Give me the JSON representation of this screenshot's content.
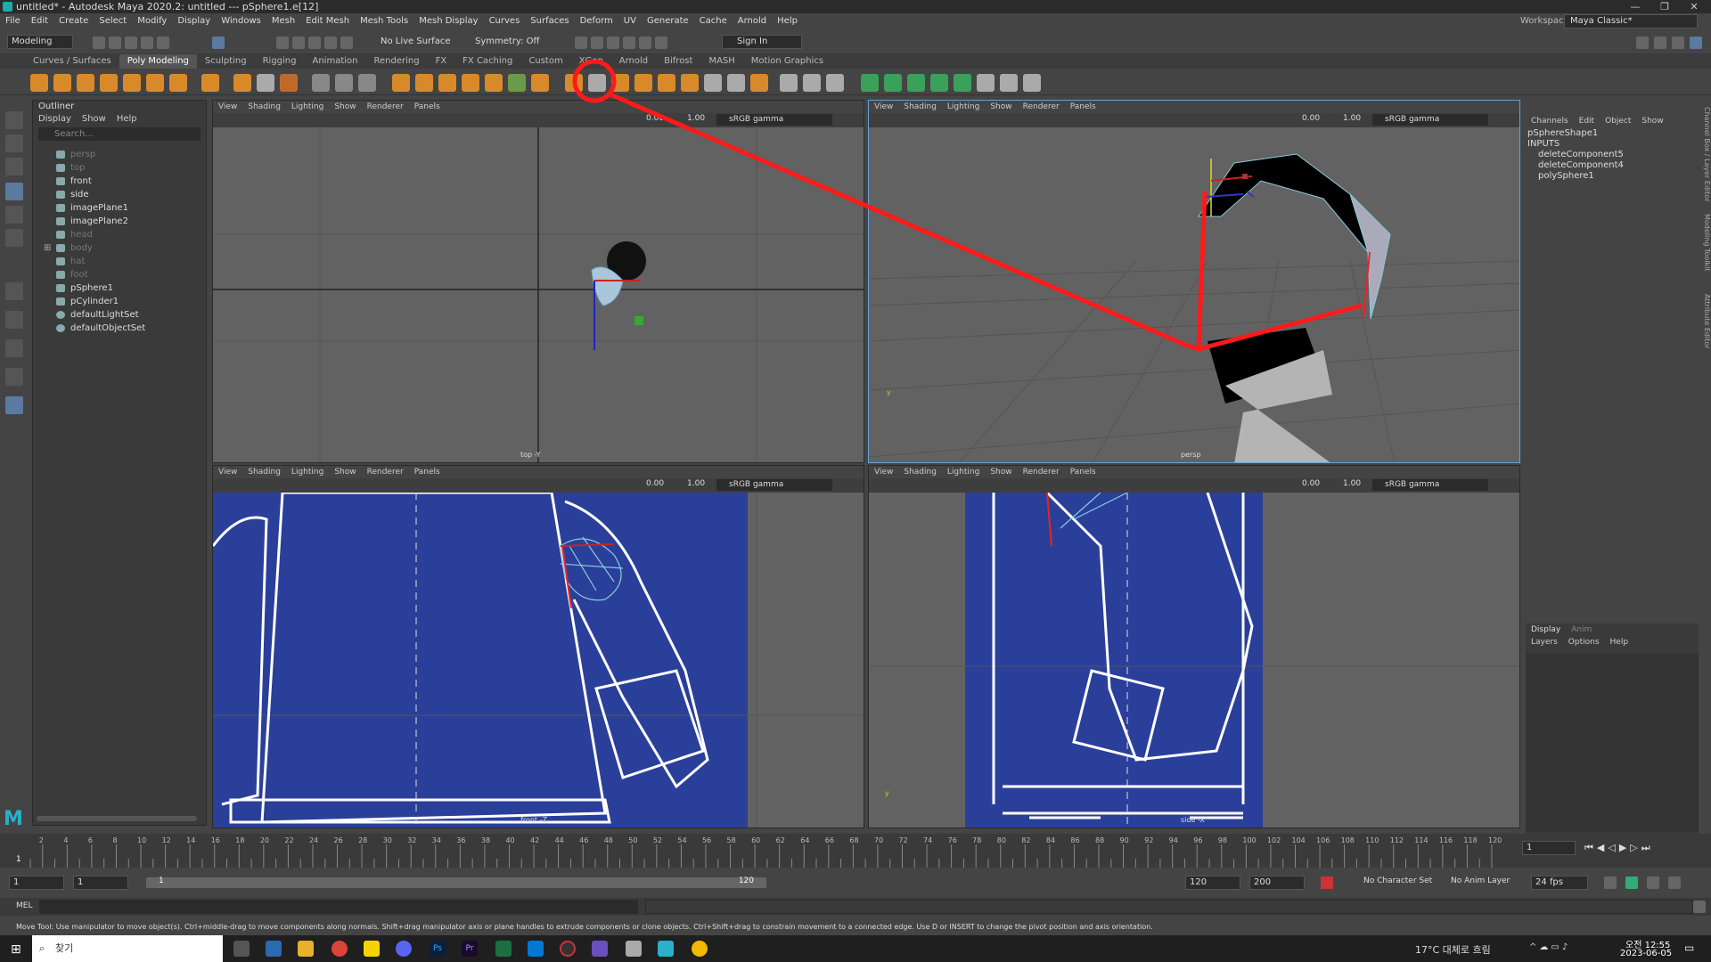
{
  "window": {
    "title": "untitled* - Autodesk Maya 2020.2: untitled   ---   pSphere1.e[12]"
  },
  "menubar": [
    "File",
    "Edit",
    "Create",
    "Select",
    "Modify",
    "Display",
    "Windows",
    "Mesh",
    "Edit Mesh",
    "Mesh Tools",
    "Mesh Display",
    "Curves",
    "Surfaces",
    "Deform",
    "UV",
    "Generate",
    "Cache",
    "Arnold",
    "Help"
  ],
  "workspace": {
    "label": "Workspace :",
    "value": "Maya Classic*"
  },
  "status": {
    "mode": "Modeling",
    "live_surface": "No Live Surface",
    "symmetry": "Symmetry: Off",
    "sign_in": "Sign In"
  },
  "shelf_tabs": [
    "Curves / Surfaces",
    "Poly Modeling",
    "Sculpting",
    "Rigging",
    "Animation",
    "Rendering",
    "FX",
    "FX Caching",
    "Custom",
    "XGen",
    "Arnold",
    "Bifrost",
    "MASH",
    "Motion Graphics"
  ],
  "shelf_active": "Poly Modeling",
  "outliner": {
    "title": "Outliner",
    "menu": [
      "Display",
      "Show",
      "Help"
    ],
    "search_placeholder": "Search...",
    "items": [
      {
        "label": "persp",
        "dim": true
      },
      {
        "label": "top",
        "dim": true
      },
      {
        "label": "front",
        "dim": false
      },
      {
        "label": "side",
        "dim": false
      },
      {
        "label": "imagePlane1",
        "dim": false
      },
      {
        "label": "imagePlane2",
        "dim": false
      },
      {
        "label": "head",
        "dim": true
      },
      {
        "label": "body",
        "dim": true
      },
      {
        "label": "hat",
        "dim": true
      },
      {
        "label": "foot",
        "dim": true
      },
      {
        "label": "pSphere1",
        "dim": false
      },
      {
        "label": "pCylinder1",
        "dim": false
      },
      {
        "label": "defaultLightSet",
        "dim": false
      },
      {
        "label": "defaultObjectSet",
        "dim": false
      }
    ]
  },
  "viewport_menu": [
    "View",
    "Shading",
    "Lighting",
    "Show",
    "Renderer",
    "Panels"
  ],
  "viewports": [
    {
      "label": "top -Y",
      "num1": "0.00",
      "num2": "1.00",
      "gamma": "sRGB gamma"
    },
    {
      "label": "persp",
      "num1": "0.00",
      "num2": "1.00",
      "gamma": "sRGB gamma"
    },
    {
      "label": "front -Z",
      "num1": "0.00",
      "num2": "1.00",
      "gamma": "sRGB gamma"
    },
    {
      "label": "side -X",
      "num1": "0.00",
      "num2": "1.00",
      "gamma": "sRGB gamma"
    }
  ],
  "channel_box": {
    "menu": [
      "Channels",
      "Edit",
      "Object",
      "Show"
    ],
    "shape": "pSphereShape1",
    "inputs_label": "INPUTS",
    "inputs": [
      "deleteComponent5",
      "deleteComponent4",
      "polySphere1"
    ],
    "side_tabs": [
      "Channel Box / Layer Editor",
      "Modeling Toolkit",
      "Attribute Editor"
    ]
  },
  "layer_editor": {
    "tabs": [
      "Display",
      "Anim"
    ],
    "menu": [
      "Layers",
      "Options",
      "Help"
    ]
  },
  "timeline": {
    "ticks": [
      "2",
      "4",
      "6",
      "8",
      "10",
      "12",
      "14",
      "16",
      "18",
      "20",
      "22",
      "24",
      "26",
      "28",
      "30",
      "32",
      "34",
      "36",
      "38",
      "40",
      "42",
      "44",
      "46",
      "48",
      "50",
      "52",
      "54",
      "56",
      "58",
      "60",
      "62",
      "64",
      "66",
      "68",
      "70",
      "72",
      "74",
      "76",
      "78",
      "80",
      "82",
      "84",
      "86",
      "88",
      "90",
      "92",
      "94",
      "96",
      "98",
      "100",
      "102",
      "104",
      "106",
      "108",
      "110",
      "112",
      "114",
      "116",
      "118",
      "120"
    ],
    "current_frame": "1",
    "frame_field": "1"
  },
  "range": {
    "start": "1",
    "playback_start": "1",
    "range_start": "1",
    "range_end": "120",
    "end": "120",
    "anim_end": "200",
    "character_set": "No Character Set",
    "anim_layer": "No Anim Layer",
    "fps": "24 fps"
  },
  "mel": {
    "label": "MEL"
  },
  "helpline": "Move Tool: Use manipulator to move object(s). Ctrl+middle-drag to move components along normals. Shift+drag manipulator axis or plane handles to extrude components or clone objects. Ctrl+Shift+drag to constrain movement to a connected edge. Use D or INSERT to change the pivot position and axis orientation.",
  "taskbar": {
    "search": "찾기",
    "weather": "17°C 대체로 흐림",
    "time": "오전 12:55",
    "date": "2023-06-05"
  },
  "colors": {
    "annotation": "#ff1a1a",
    "imageplane": "#2a3f9a",
    "selected": "#6aa0d8"
  }
}
